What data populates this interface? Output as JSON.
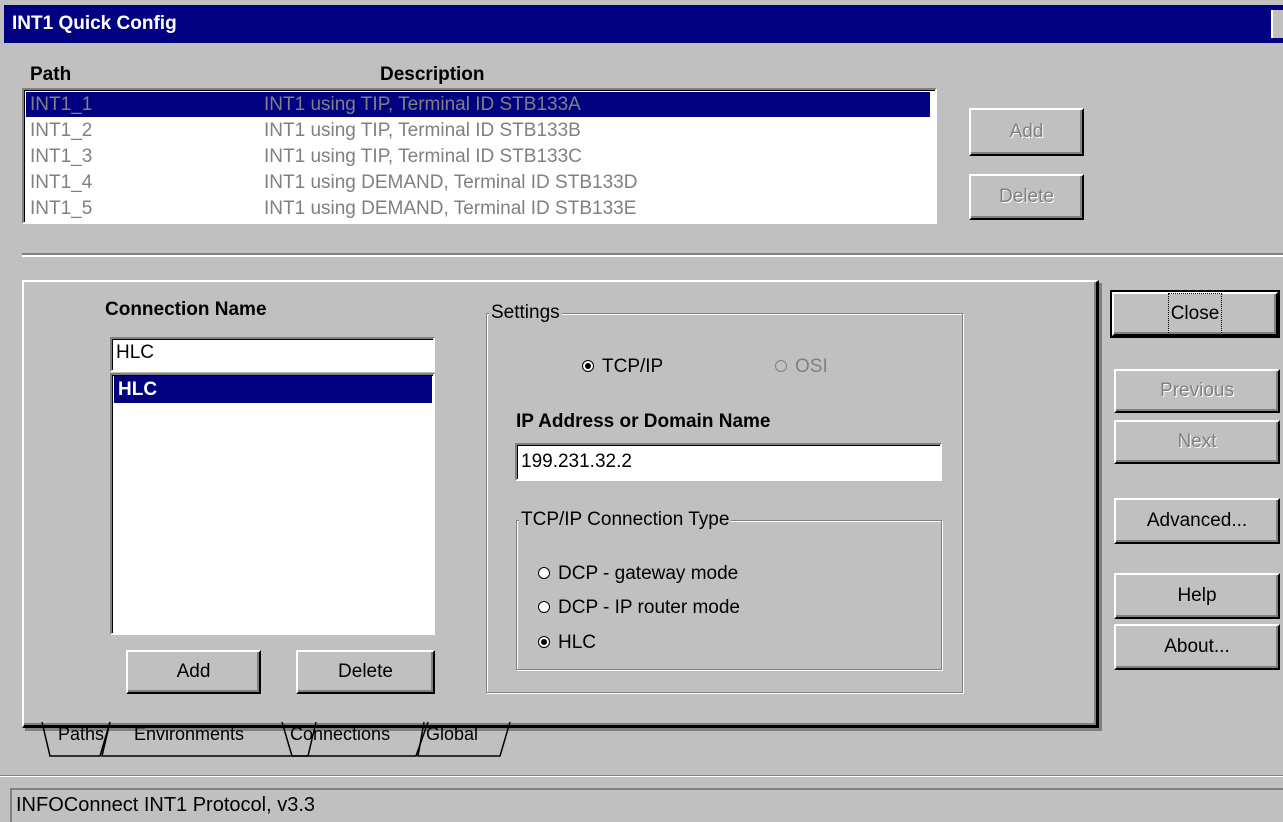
{
  "window": {
    "title": "INT1 Quick Config"
  },
  "paths": {
    "col_path": "Path",
    "col_description": "Description",
    "rows": [
      {
        "path": "INT1_1",
        "description": "INT1 using TIP, Terminal ID STB133A",
        "selected": true
      },
      {
        "path": "INT1_2",
        "description": "INT1 using TIP, Terminal ID STB133B"
      },
      {
        "path": "INT1_3",
        "description": "INT1 using TIP, Terminal ID STB133C"
      },
      {
        "path": "INT1_4",
        "description": "INT1 using DEMAND, Terminal ID STB133D"
      },
      {
        "path": "INT1_5",
        "description": "INT1 using DEMAND, Terminal ID STB133E"
      }
    ],
    "add_label": "Add",
    "delete_label": "Delete"
  },
  "connection": {
    "name_label": "Connection Name",
    "name_value": "HLC",
    "list": [
      "HLC"
    ],
    "add_label": "Add",
    "delete_label": "Delete"
  },
  "settings": {
    "legend": "Settings",
    "tcpip_label": "TCP/IP",
    "osi_label": "OSI",
    "selected_protocol": "TCP/IP",
    "ip_label": "IP Address or Domain Name",
    "ip_value": "199.231.32.2",
    "conn_type_legend": "TCP/IP Connection Type",
    "conn_types": [
      "DCP - gateway mode",
      "DCP - IP router mode",
      "HLC"
    ],
    "selected_conn_type": "HLC"
  },
  "side_buttons": {
    "close": "Close",
    "previous": "Previous",
    "next": "Next",
    "advanced": "Advanced...",
    "help": "Help",
    "about": "About..."
  },
  "tabs": [
    "Paths",
    "Environments",
    "Connections",
    "Global"
  ],
  "active_tab": "Connections",
  "status": {
    "text": "INFOConnect INT1 Protocol, v3.3"
  },
  "colors": {
    "selection": "#000080",
    "face": "#c0c0c0",
    "disabled_text": "#808080"
  }
}
